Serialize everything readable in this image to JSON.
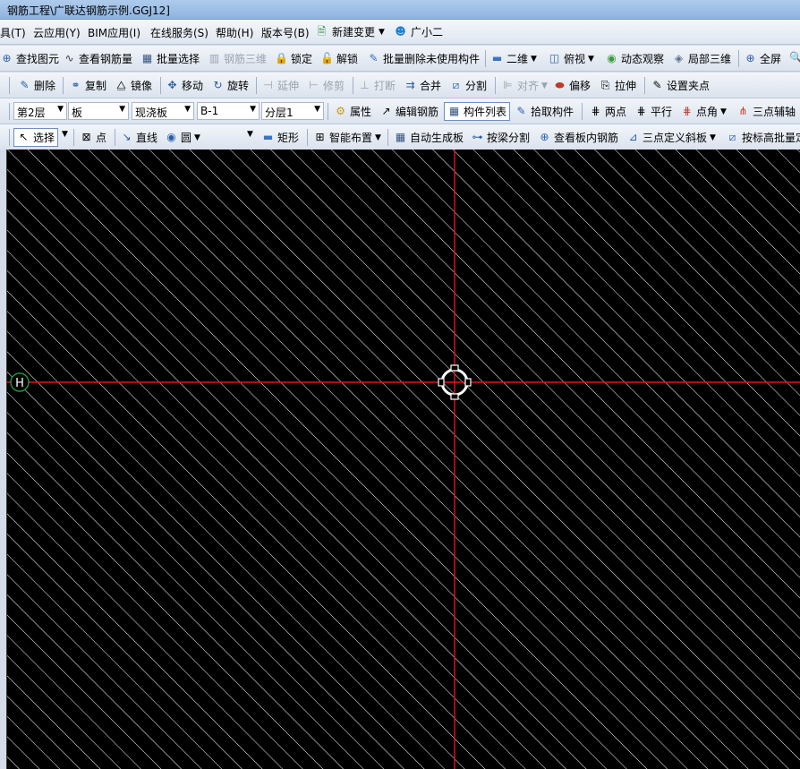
{
  "title": "钢筋工程\\广联达钢筋示例.GGJ12]",
  "menu": [
    "具(T)",
    "云应用(Y)",
    "BIM应用(I)",
    "在线服务(S)",
    "帮助(H)",
    "版本号(B)",
    "新建变更",
    "广小二"
  ],
  "toolbar1": [
    "查找图元",
    "查看钢筋量",
    "批量选择",
    "钢筋三维",
    "锁定",
    "解锁",
    "批量删除未使用构件",
    "二维",
    "俯视",
    "动态观察",
    "局部三维",
    "全屏"
  ],
  "toolbar2": [
    "删除",
    "复制",
    "镜像",
    "移动",
    "旋转",
    "延伸",
    "修剪",
    "打断",
    "合并",
    "分割",
    "对齐",
    "偏移",
    "拉伸",
    "设置夹点"
  ],
  "toolbar3": {
    "floor": "第2层",
    "type": "板",
    "subtype": "现浇板",
    "component": "B-1",
    "layer": "分层1",
    "buttons": [
      "属性",
      "编辑钢筋",
      "构件列表",
      "拾取构件",
      "两点",
      "平行",
      "点角",
      "三点辅轴"
    ]
  },
  "toolbar4": [
    "选择",
    "点",
    "直线",
    "圆",
    "矩形",
    "智能布置",
    "自动生成板",
    "按梁分割",
    "查看板内钢筋",
    "三点定义斜板",
    "按标高批量定"
  ],
  "canvas": {
    "axis_label": "H",
    "background": "#000000",
    "hatch_color": "#ffffff",
    "axis_color": "#e0141a",
    "axis_bubble_color": "#1f9a3a"
  }
}
